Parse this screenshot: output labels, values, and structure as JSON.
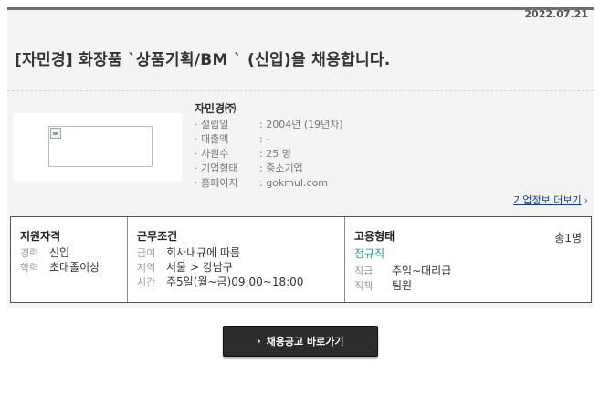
{
  "date": "2022.07.21",
  "title": "[자민경] 화장품 `상품기획/BM ` (신입)을 채용합니다.",
  "company": {
    "name": "자민경㈜",
    "info": [
      {
        "label": "· 설립일",
        "value": ": 2004년 (19년차)"
      },
      {
        "label": "· 매출액",
        "value": ": -"
      },
      {
        "label": "· 사원수",
        "value": ": 25 명"
      },
      {
        "label": "· 기업형태",
        "value": ": 중소기업"
      },
      {
        "label": "· 홈페이지",
        "value": ": gokmul.com"
      }
    ],
    "more_link": "기업정보 더보기"
  },
  "qualification": {
    "heading": "지원자격",
    "rows": [
      {
        "label": "경력",
        "value": "신입"
      },
      {
        "label": "학력",
        "value": "초대졸이상"
      }
    ]
  },
  "conditions": {
    "heading": "근무조건",
    "rows": [
      {
        "label": "급여",
        "value": "회사내규에 따름"
      },
      {
        "label": "지역",
        "value": "서울 > 강남구"
      },
      {
        "label": "시간",
        "value": "주5일(월~금)09:00~18:00"
      }
    ]
  },
  "employment": {
    "heading": "고용형태",
    "count": "총1명",
    "type": "정규직",
    "rows": [
      {
        "label": "직급",
        "value": "주임~대리급"
      },
      {
        "label": "직책",
        "value": "팀원"
      }
    ]
  },
  "button_label": "채용공고 바로가기"
}
